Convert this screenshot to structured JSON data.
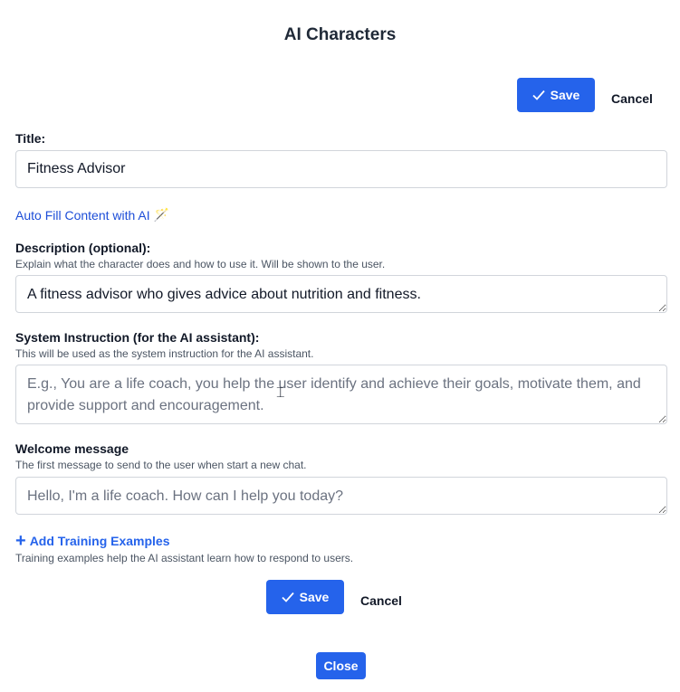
{
  "header": {
    "title": "AI Characters"
  },
  "actions": {
    "save_label": "Save",
    "cancel_label": "Cancel",
    "close_label": "Close"
  },
  "form": {
    "title": {
      "label": "Title:",
      "value": "Fitness Advisor"
    },
    "autofill": {
      "label": "Auto Fill Content with AI",
      "icon": "magic-wand-icon"
    },
    "description": {
      "label": "Description (optional):",
      "help": "Explain what the character does and how to use it. Will be shown to the user.",
      "value": "A fitness advisor who gives advice about nutrition and fitness."
    },
    "system_instruction": {
      "label": "System Instruction (for the AI assistant):",
      "help": "This will be used as the system instruction for the AI assistant.",
      "placeholder": "E.g., You are a life coach, you help the user identify and achieve their goals, motivate them, and provide support and encouragement."
    },
    "welcome": {
      "label": "Welcome message",
      "help": "The first message to send to the user when start a new chat.",
      "placeholder": "Hello, I'm a life coach. How can I help you today?"
    },
    "training": {
      "label": "Add Training Examples",
      "help": "Training examples help the AI assistant learn how to respond to users."
    }
  },
  "colors": {
    "primary": "#2563eb",
    "link": "#1d4ed8",
    "border": "#d1d5db"
  }
}
